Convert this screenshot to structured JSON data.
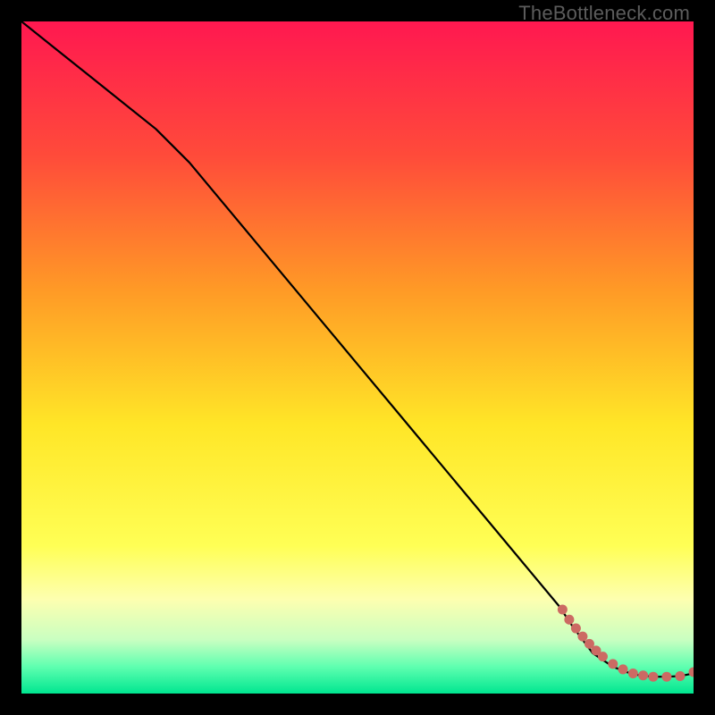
{
  "watermark": "TheBottleneck.com",
  "chart_data": {
    "type": "line",
    "title": "",
    "xlabel": "",
    "ylabel": "",
    "xlim": [
      0,
      100
    ],
    "ylim": [
      0,
      100
    ],
    "grid": false,
    "legend": false,
    "background_gradient": {
      "stops": [
        {
          "offset": 0.0,
          "color": "#ff1850"
        },
        {
          "offset": 0.2,
          "color": "#ff4b3a"
        },
        {
          "offset": 0.4,
          "color": "#ff9a26"
        },
        {
          "offset": 0.6,
          "color": "#ffe627"
        },
        {
          "offset": 0.78,
          "color": "#ffff55"
        },
        {
          "offset": 0.86,
          "color": "#fdffb0"
        },
        {
          "offset": 0.92,
          "color": "#c9ffc1"
        },
        {
          "offset": 0.96,
          "color": "#5fffb0"
        },
        {
          "offset": 1.0,
          "color": "#00e690"
        }
      ]
    },
    "series": [
      {
        "name": "curve",
        "color": "#000000",
        "x": [
          0,
          5,
          10,
          15,
          20,
          25,
          30,
          35,
          40,
          45,
          50,
          55,
          60,
          65,
          70,
          75,
          80,
          82,
          85,
          88,
          90,
          92,
          94,
          96,
          98,
          100
        ],
        "y": [
          100,
          96,
          92,
          88,
          84,
          79,
          73,
          67,
          61,
          55,
          49,
          43,
          37,
          31,
          25,
          19,
          13,
          10,
          6,
          4,
          3.2,
          2.7,
          2.5,
          2.5,
          2.6,
          3
        ]
      }
    ],
    "scatter": {
      "name": "highlight-points",
      "color": "#cc6a63",
      "points": [
        {
          "x": 80.5,
          "y": 12.5
        },
        {
          "x": 81.5,
          "y": 11.0
        },
        {
          "x": 82.5,
          "y": 9.7
        },
        {
          "x": 83.5,
          "y": 8.5
        },
        {
          "x": 84.5,
          "y": 7.4
        },
        {
          "x": 85.5,
          "y": 6.4
        },
        {
          "x": 86.5,
          "y": 5.5
        },
        {
          "x": 88.0,
          "y": 4.4
        },
        {
          "x": 89.5,
          "y": 3.6
        },
        {
          "x": 91.0,
          "y": 3.0
        },
        {
          "x": 92.5,
          "y": 2.7
        },
        {
          "x": 94.0,
          "y": 2.5
        },
        {
          "x": 96.0,
          "y": 2.5
        },
        {
          "x": 98.0,
          "y": 2.6
        },
        {
          "x": 100.0,
          "y": 3.2
        }
      ]
    }
  }
}
